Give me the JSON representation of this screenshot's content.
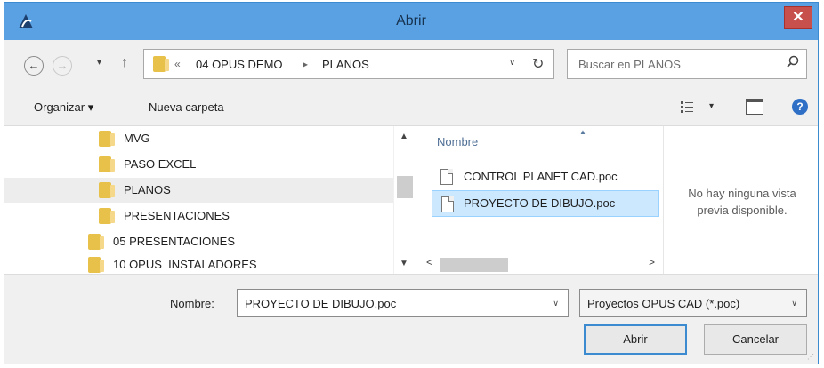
{
  "window": {
    "title": "Abrir",
    "close_label": "✕"
  },
  "address": {
    "prefix": "«",
    "crumbs": [
      "04 OPUS DEMO",
      "PLANOS"
    ],
    "separator": "▸"
  },
  "search": {
    "placeholder": "Buscar en PLANOS"
  },
  "toolbar": {
    "organize": "Organizar ▾",
    "new_folder": "Nueva carpeta",
    "view_dropdown": "▾",
    "help": "?"
  },
  "tree": {
    "items": [
      {
        "label": "MVG",
        "indent": 1
      },
      {
        "label": "PASO EXCEL",
        "indent": 1
      },
      {
        "label": "PLANOS",
        "indent": 1,
        "selected": true
      },
      {
        "label": "PRESENTACIONES",
        "indent": 1
      },
      {
        "label": "05 PRESENTACIONES",
        "indent": 0
      },
      {
        "label": "10 OPUS  INSTALADORES",
        "indent": 0
      }
    ]
  },
  "files": {
    "column_header": "Nombre",
    "items": [
      {
        "name": "CONTROL PLANET CAD.poc",
        "selected": false
      },
      {
        "name": "PROYECTO DE DIBUJO.poc",
        "selected": true
      }
    ]
  },
  "preview": {
    "message": "No hay ninguna vista previa disponible."
  },
  "bottom": {
    "name_label": "Nombre:",
    "name_value": "PROYECTO DE DIBUJO.poc",
    "file_type": "Proyectos OPUS CAD (*.poc)",
    "open_button": "Abrir",
    "cancel_button": "Cancelar"
  },
  "colors": {
    "titlebar": "#5aa1e3",
    "close": "#c7504c",
    "selection": "#cce8ff",
    "folder": "#e8c14a"
  }
}
